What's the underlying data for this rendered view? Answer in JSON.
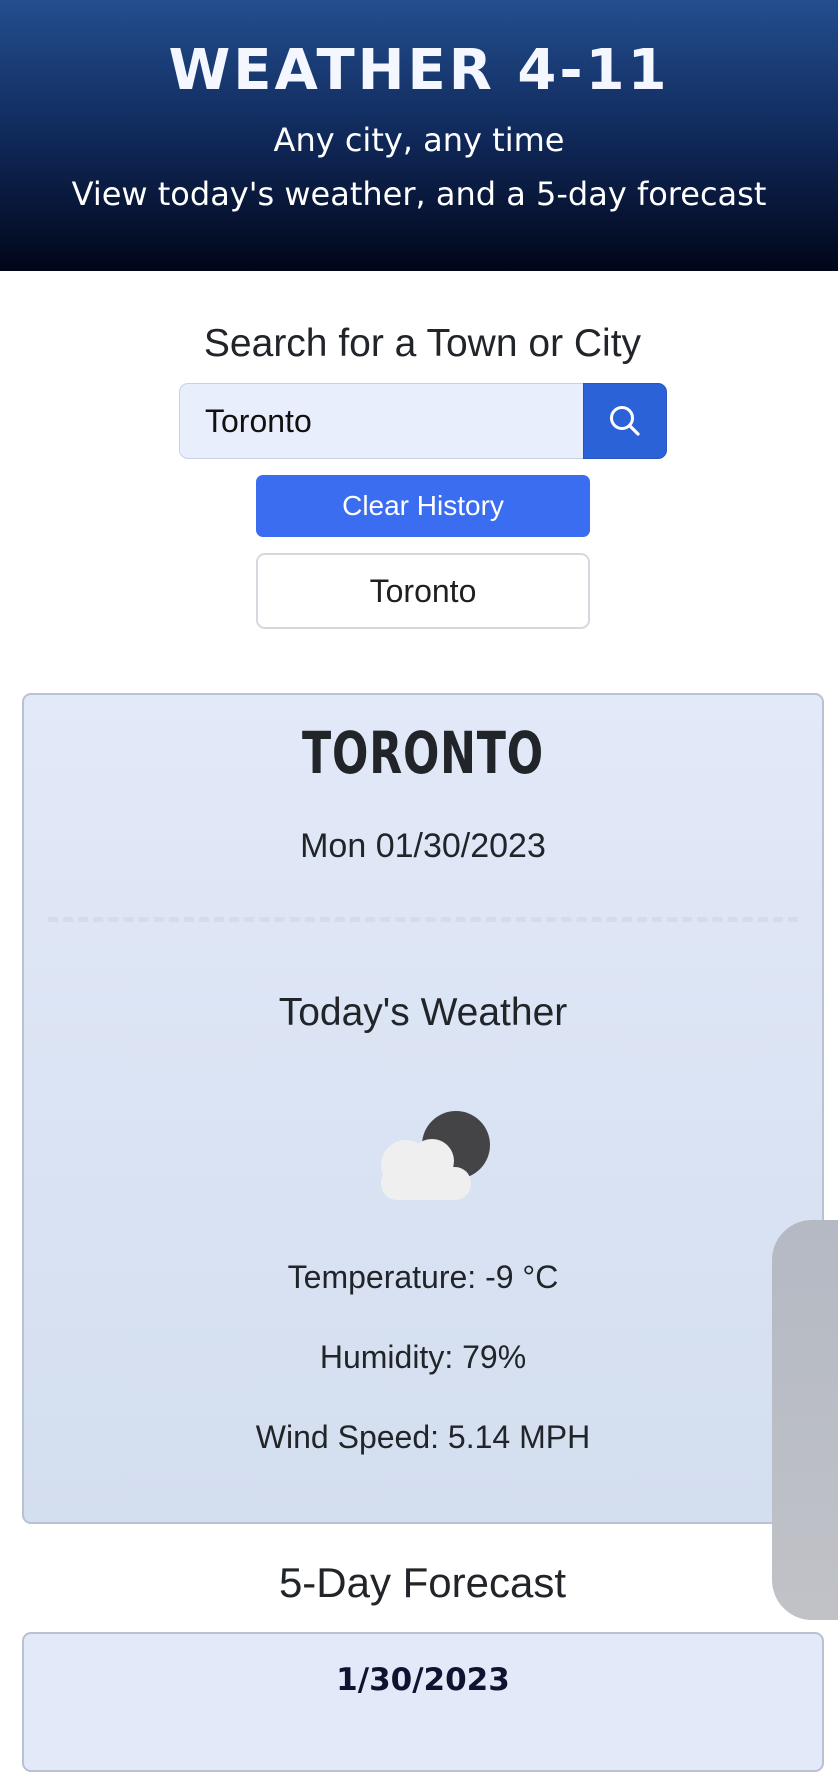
{
  "header": {
    "title": "WEATHER 4-11",
    "subtitle_line1": "Any city, any time",
    "subtitle_line2": "View today's weather, and a 5-day forecast"
  },
  "search": {
    "heading": "Search for a Town or City",
    "input_value": "Toronto",
    "button_icon": "search-icon",
    "clear_history_label": "Clear History",
    "history": [
      "Toronto"
    ]
  },
  "today": {
    "city": "TORONTO",
    "date": "Mon 01/30/2023",
    "heading": "Today's Weather",
    "icon": "cloud-night-icon",
    "temperature": "Temperature: -9 °C",
    "humidity": "Humidity: 79%",
    "wind_speed": "Wind Speed: 5.14 MPH"
  },
  "forecast": {
    "heading": "5-Day Forecast",
    "days": [
      {
        "date": "1/30/2023"
      }
    ]
  },
  "colors": {
    "header_top": "#234e8f",
    "header_bottom": "#010619",
    "primary_button": "#3a6df0",
    "search_button": "#2b62d7",
    "card_background": "#e2e9f8"
  }
}
